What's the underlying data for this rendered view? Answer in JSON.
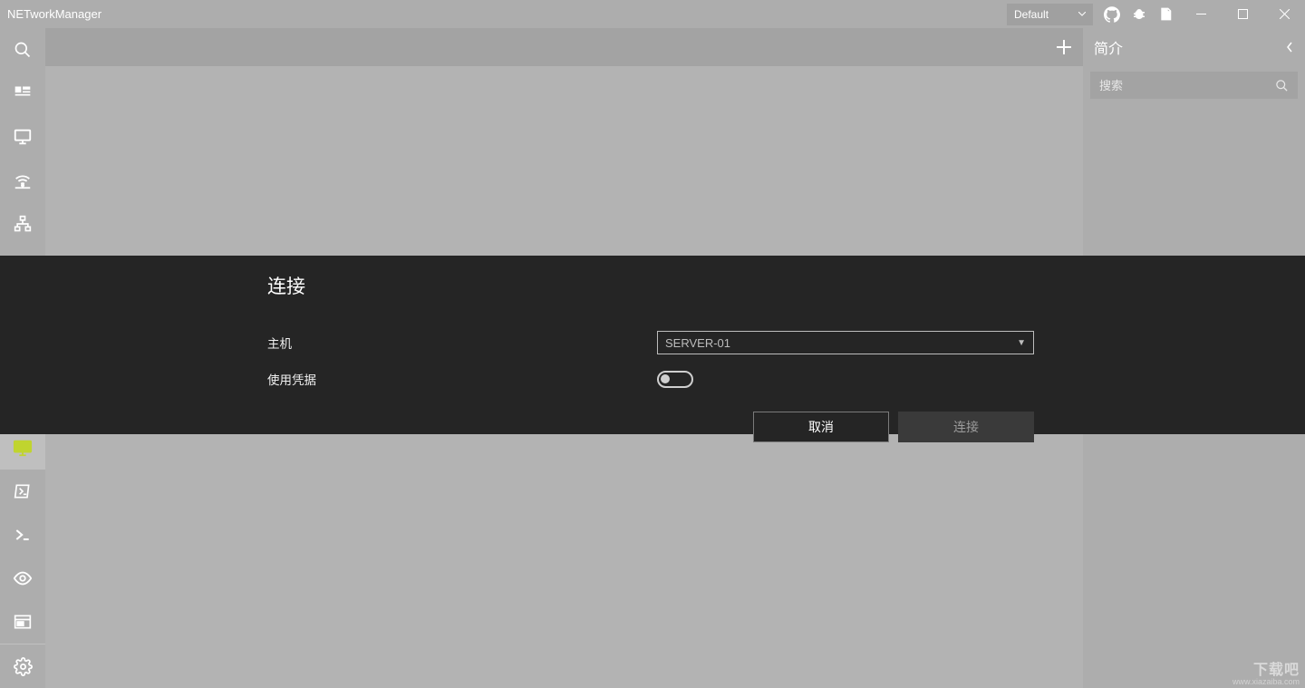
{
  "app": {
    "title": "NETworkManager"
  },
  "titlebar": {
    "profile_selected": "Default",
    "icons": {
      "github": "github-icon",
      "bug": "bug-icon",
      "docs": "docs-icon"
    }
  },
  "tabs": {
    "add_label": "+"
  },
  "right_panel": {
    "title": "简介",
    "search_placeholder": "搜索"
  },
  "modal": {
    "title": "连接",
    "host_label": "主机",
    "host_placeholder": "SERVER-01",
    "use_credentials_label": "使用凭据",
    "cancel": "取消",
    "connect": "连接"
  },
  "watermark": {
    "line1": "下载吧",
    "line2": "www.xiazaiba.com"
  }
}
